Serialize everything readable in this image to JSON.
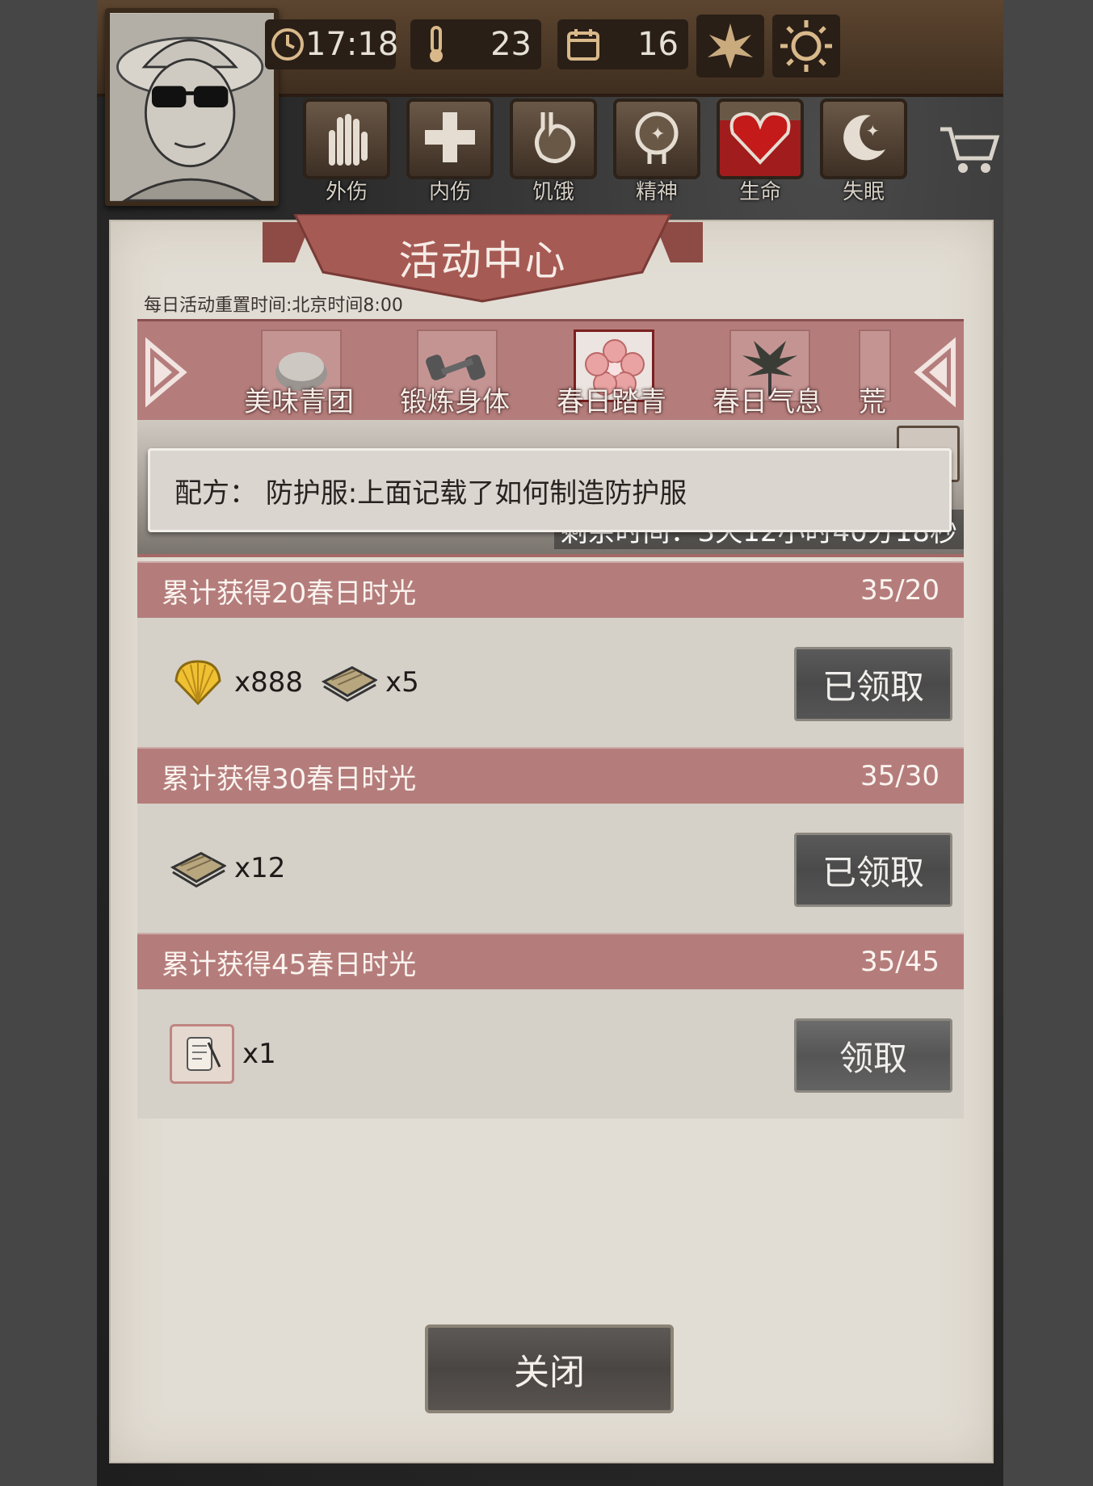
{
  "hud": {
    "time": "17:18",
    "temperature": "23",
    "day": "16",
    "season_icon": "leaf-icon",
    "weather_icon": "sun-icon"
  },
  "status_bars": [
    {
      "label": "外伤",
      "icon": "hand-icon"
    },
    {
      "label": "内伤",
      "icon": "cross-icon"
    },
    {
      "label": "饥饿",
      "icon": "stomach-icon"
    },
    {
      "label": "精神",
      "icon": "head-icon"
    },
    {
      "label": "生命",
      "icon": "heart-icon"
    },
    {
      "label": "失眠",
      "icon": "moon-icon"
    }
  ],
  "panel": {
    "title": "活动中心",
    "reset_note": "每日活动重置时间:北京时间8:00",
    "close_label": "关闭"
  },
  "tabs": [
    {
      "label": "美味青团",
      "active": false
    },
    {
      "label": "锻炼身体",
      "active": false
    },
    {
      "label": "春日踏青",
      "active": true
    },
    {
      "label": "春日气息",
      "active": false
    },
    {
      "label": "荒",
      "active": false
    }
  ],
  "left_partial_tab": "​",
  "banner": {
    "remaining": "剩余时间：3天12小时40分18秒"
  },
  "tooltip": {
    "text": "配方： 防护服:上面记载了如何制造防护服"
  },
  "tasks": [
    {
      "title": "累计获得20春日时光",
      "progress": "35/20",
      "rewards": [
        {
          "icon": "shell-icon",
          "qty": "x888"
        },
        {
          "icon": "wood-planks-icon",
          "qty": "x5"
        }
      ],
      "button": "已领取"
    },
    {
      "title": "累计获得30春日时光",
      "progress": "35/30",
      "rewards": [
        {
          "icon": "wood-planks-icon",
          "qty": "x12"
        }
      ],
      "button": "已领取"
    },
    {
      "title": "累计获得45春日时光",
      "progress": "35/45",
      "rewards": [
        {
          "icon": "recipe-scroll-icon",
          "qty": "x1"
        }
      ],
      "button": "领取"
    }
  ],
  "colors": {
    "tab_bar": "#b47d7b",
    "panel_paper": "#e2ddd4",
    "button_dark": "#4a4a4a"
  }
}
